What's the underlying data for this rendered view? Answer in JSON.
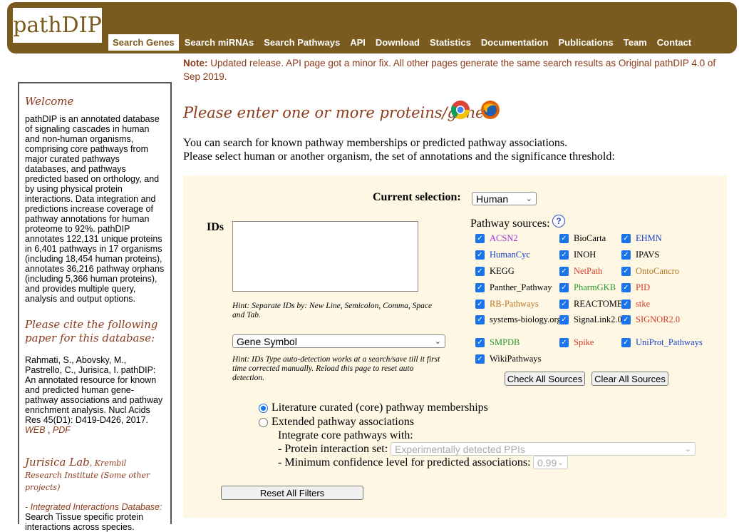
{
  "header": {
    "logo": "pathDIP",
    "nav": [
      "Search Genes",
      "Search miRNAs",
      "Search Pathways",
      "API",
      "Download",
      "Statistics",
      "Documentation",
      "Publications",
      "Team",
      "Contact"
    ],
    "active_nav": "Search Genes"
  },
  "note": {
    "label": "Note:",
    "text": " Updated release. API page got a minor fix. All other pages generate the same search results as Original pathDIP 4.0 of Sep 2019."
  },
  "sidebar": {
    "welcome_heading": "Welcome",
    "welcome_text": "pathDIP is an annotated database of signaling cascades in human and non-human organisms, comprising core pathways from major curated pathways databases, and pathways predicted based on orthology, and by using physical protein interactions. Data integration and predictions increase coverage of pathway annotations for human proteome to 92%. pathDIP annotates 122,131 unique proteins in 6,401 pathways in 17 organisms (including 18,454 human proteins), annotates 36,216 pathway orphans (including 5,366 human proteins), and provides multiple query, analysis and output options.",
    "cite_heading": "Please cite the following paper for this database:",
    "citation": "Rahmati, S., Abovsky, M., Pastrello, C., Jurisica, I. pathDIP: An annotated resource for known and predicted human gene-pathway associations and pathway enrichment analysis. Nucl Acids Res 45(D1): D419-D426, 2017.",
    "web_link": "WEB",
    "pdf_link": "PDF",
    "lab_title": "Jurisica Lab",
    "lab_subtitle": ", Krembil Research Institute (Some other projects)",
    "iid_link": "- Integrated Interactions Database:",
    "iid_text": "Search Tissue specific protein interactions across species."
  },
  "main": {
    "heading": "Please enter one or more proteins/genes.",
    "browser_icons": [
      "chrome-icon",
      "firefox-icon"
    ],
    "intro_line1": "You can search for known pathway memberships or predicted pathway associations.",
    "intro_line2": "Please select human or another organism, the set of annotations and the significance threshold:"
  },
  "form": {
    "current_selection_label": "Current selection:",
    "organism": "Human",
    "ids_label": "IDs",
    "ids_value": "",
    "ids_hint": "Hint: Separate IDs by: New Line, Semicolon, Comma, Space and Tab.",
    "id_type": "Gene Symbol",
    "id_type_hint": "Hint: IDs Type auto-detection works at a search/save till it first time corrected manually. Reload this page to reset auto detection.",
    "sources_label": "Pathway sources:",
    "sources": [
      {
        "name": "ACSN2",
        "color": "#9b30d9",
        "checked": true
      },
      {
        "name": "BioCarta",
        "color": "#000000",
        "checked": true
      },
      {
        "name": "EHMN",
        "color": "#1a3fc7",
        "checked": true
      },
      {
        "name": "HumanCyc",
        "color": "#1a3fc7",
        "checked": true
      },
      {
        "name": "INOH",
        "color": "#000000",
        "checked": true
      },
      {
        "name": "IPAVS",
        "color": "#000000",
        "checked": true
      },
      {
        "name": "KEGG",
        "color": "#000000",
        "checked": true
      },
      {
        "name": "NetPath",
        "color": "#d63a2a",
        "checked": true
      },
      {
        "name": "OntoCancro",
        "color": "#b8772a",
        "checked": true
      },
      {
        "name": "Panther_Pathway",
        "color": "#000000",
        "checked": true
      },
      {
        "name": "PharmGKB",
        "color": "#2e9a2e",
        "checked": true
      },
      {
        "name": "PID",
        "color": "#d63a2a",
        "checked": true
      },
      {
        "name": "RB-Pathways",
        "color": "#b8772a",
        "checked": true
      },
      {
        "name": "REACTOME",
        "color": "#000000",
        "checked": true
      },
      {
        "name": "stke",
        "color": "#d63a2a",
        "checked": true
      },
      {
        "name": "systems-biology.org",
        "color": "#000000",
        "checked": true
      },
      {
        "name": "SignaLink2.0",
        "color": "#000000",
        "checked": true
      },
      {
        "name": "SIGNOR2.0",
        "color": "#d63a2a",
        "checked": true
      },
      {
        "name": "SMPDB",
        "color": "#2e9a2e",
        "checked": true
      },
      {
        "name": "Spike",
        "color": "#d63a2a",
        "checked": true
      },
      {
        "name": "UniProt_Pathways",
        "color": "#1a3fc7",
        "checked": true
      },
      {
        "name": "WikiPathways",
        "color": "#000000",
        "checked": true
      }
    ],
    "check_all": "Check All Sources",
    "clear_all": "Clear All Sources",
    "radio_core": "Literature curated (core) pathway memberships",
    "radio_extended": "Extended pathway associations",
    "integrate_label": "Integrate core pathways with:",
    "interaction_label": "- Protein interaction set:",
    "interaction_value": "Experimentally detected PPIs",
    "confidence_label": "- Minimum confidence level for predicted associations:",
    "confidence_value": "0.99",
    "reset_button": "Reset All Filters"
  }
}
